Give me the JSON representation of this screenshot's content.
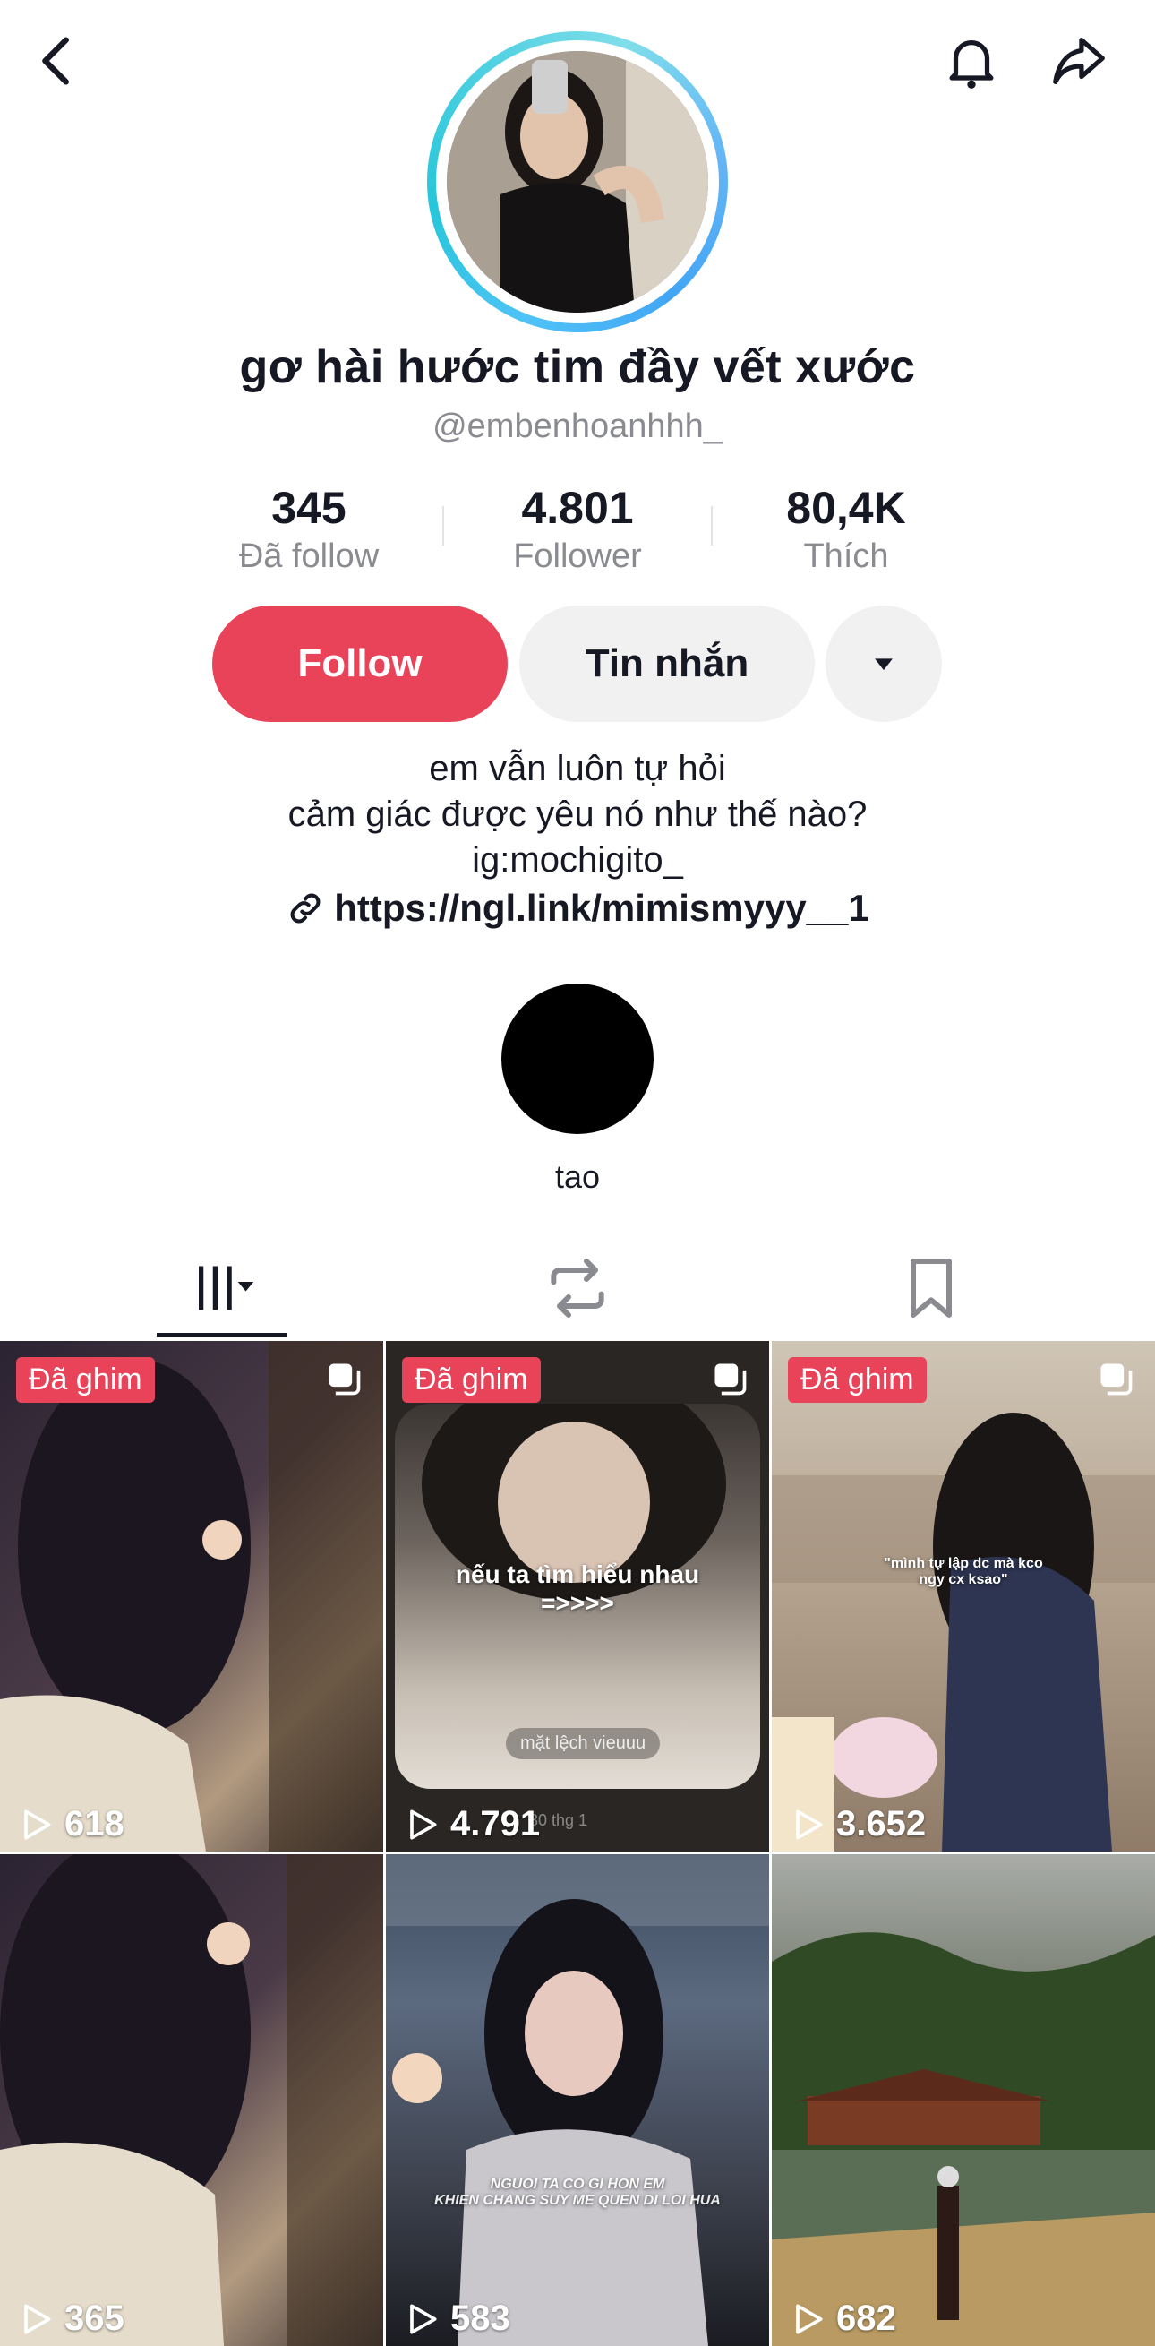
{
  "profile": {
    "name": "gơ hài hước tim đầy vết xước",
    "handle": "@embenhoanhhh_",
    "stats": [
      {
        "value": "345",
        "label": "Đã follow"
      },
      {
        "value": "4.801",
        "label": "Follower"
      },
      {
        "value": "80,4K",
        "label": "Thích"
      }
    ],
    "follow_label": "Follow",
    "message_label": "Tin nhắn",
    "bio": [
      "em vẫn luôn tự hỏi",
      "cảm giác được yêu nó như thế nào?",
      "ig:mochigito_"
    ],
    "link": "https://ngl.link/mimismyyy__1",
    "highlight_label": "tao"
  },
  "colors": {
    "accent": "#e94359",
    "muted": "#8a8b91",
    "button_bg": "#f1f1f2"
  },
  "icons": {
    "back": "chevron-left",
    "bell": "bell",
    "share": "share-arrow",
    "tabs": [
      "grid-icon",
      "repost-icon",
      "bookmark-icon"
    ]
  },
  "videos": [
    {
      "pinned": "Đã ghim",
      "views": "618",
      "caption": ""
    },
    {
      "pinned": "Đã ghim",
      "views": "4.791",
      "caption": "nếu ta tìm hiểu nhau\n=>>>>",
      "sub": "mặt lệch vieuuu",
      "date": "30 thg 1"
    },
    {
      "pinned": "Đã ghim",
      "views": "3.652",
      "caption": "\"mình tự lập dc mà kco\nngy cx ksao\""
    },
    {
      "pinned": "",
      "views": "365",
      "caption": ""
    },
    {
      "pinned": "",
      "views": "583",
      "caption": "NGUOI TA CO GI HON EM\nKHIEN CHANG SUY ME QUEN DI LOI HUA"
    },
    {
      "pinned": "",
      "views": "682",
      "caption": ""
    }
  ]
}
